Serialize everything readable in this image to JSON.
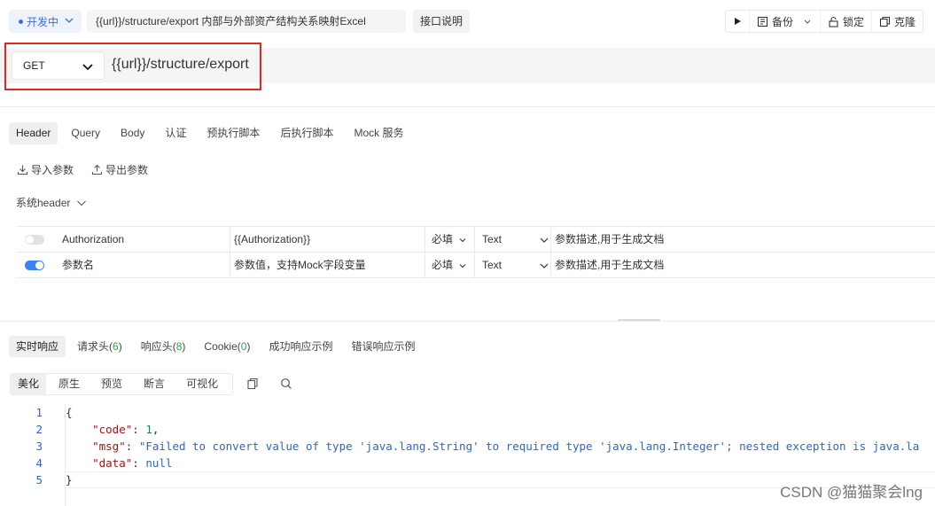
{
  "topbar": {
    "status_label": "开发中",
    "api_name": "{{url}}/structure/export 内部与外部资产结构关系映射Excel",
    "doc_button": "接口说明",
    "actions": {
      "run_icon": "play-icon",
      "backup": "备份",
      "lock": "锁定",
      "clone": "克隆"
    }
  },
  "request": {
    "method": "GET",
    "url": "{{url}}/structure/export"
  },
  "req_tabs": [
    "Header",
    "Query",
    "Body",
    "认证",
    "预执行脚本",
    "后执行脚本",
    "Mock 服务"
  ],
  "io": {
    "import": "导入参数",
    "export": "导出参数"
  },
  "sys_header": "系统header",
  "params": [
    {
      "enabled": false,
      "name": "Authorization",
      "name_placeholder": false,
      "value": "{{Authorization}}",
      "value_placeholder": false,
      "required": "必填",
      "type": "Text",
      "desc": "参数描述,用于生成文档"
    },
    {
      "enabled": true,
      "name": "参数名",
      "name_placeholder": true,
      "value": "参数值，支持Mock字段变量",
      "value_placeholder": true,
      "required": "必填",
      "type": "Text",
      "desc": "参数描述,用于生成文档"
    }
  ],
  "resp_tabs": [
    {
      "label": "实时响应",
      "count": ""
    },
    {
      "label": "请求头",
      "count": "6"
    },
    {
      "label": "响应头",
      "count": "8"
    },
    {
      "label": "Cookie",
      "count": "0"
    },
    {
      "label": "成功响应示例",
      "count": ""
    },
    {
      "label": "错误响应示例",
      "count": ""
    }
  ],
  "view_modes": [
    "美化",
    "原生",
    "预览",
    "断言",
    "可视化"
  ],
  "code": {
    "line_numbers": [
      "1",
      "2",
      "3",
      "4",
      "5"
    ],
    "open_brace": "{",
    "close_brace": "}",
    "code_key": "\"code\"",
    "code_val": "1",
    "msg_key": "\"msg\"",
    "msg_val": "\"Failed to convert value of type 'java.lang.String' to required type 'java.lang.Integer'; nested exception is java.la",
    "data_key": "\"data\"",
    "data_val": "null"
  },
  "watermark": "CSDN @猫猫聚会lng",
  "colors": {
    "accent": "#3b82f6",
    "highlight": "#e0281f",
    "count_green": "#2fa24a"
  }
}
